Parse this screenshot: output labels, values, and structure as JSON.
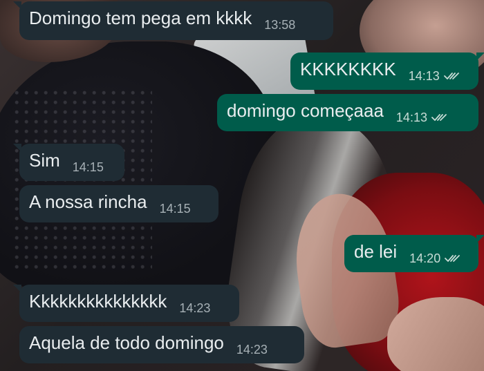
{
  "messages": [
    {
      "direction": "in",
      "text": "Domingo tem pega em kkkk",
      "time": "13:58"
    },
    {
      "direction": "out",
      "text": "KKKKKKKK",
      "time": "14:13",
      "status": "read"
    },
    {
      "direction": "out",
      "text": "domingo começaaa",
      "time": "14:13",
      "status": "read"
    },
    {
      "direction": "in",
      "text": "Sim",
      "time": "14:15"
    },
    {
      "direction": "in",
      "text": "A nossa rincha",
      "time": "14:15"
    },
    {
      "direction": "out",
      "text": "de lei",
      "time": "14:20",
      "status": "read"
    },
    {
      "direction": "in",
      "text": "Kkkkkkkkkkkkkkk",
      "time": "14:23"
    },
    {
      "direction": "in",
      "text": "Aquela de todo domingo",
      "time": "14:23"
    }
  ],
  "colors": {
    "incoming_bubble": "#1f2c34",
    "outgoing_bubble": "#005c4b",
    "text": "#e9edef",
    "read_check": "#c8dcd6"
  },
  "icons": {
    "read_receipt": "double-check-icon"
  }
}
